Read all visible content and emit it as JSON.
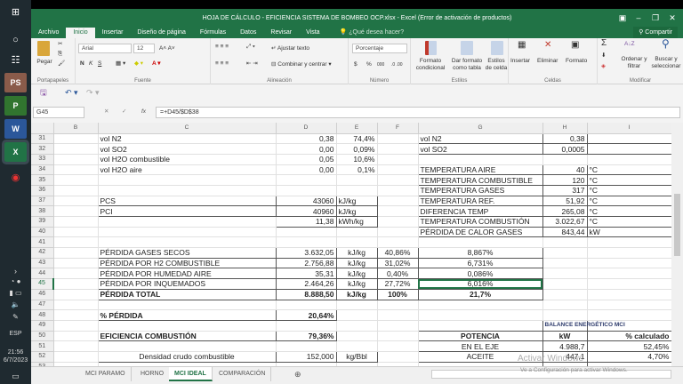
{
  "window": {
    "title": "HOJA DE CÁLCULO - EFICIENCIA SISTEMA DE BOMBEO OCP.xlsx - Excel (Error de activación de productos)",
    "share": "Compartir"
  },
  "ribbon_tabs": [
    "Archivo",
    "Inicio",
    "Insertar",
    "Diseño de página",
    "Fórmulas",
    "Datos",
    "Revisar",
    "Vista"
  ],
  "tell_me": "¿Qué desea hacer?",
  "ribbon": {
    "paste": "Pegar",
    "font_name": "Arial",
    "font_size": "12",
    "bold": "N",
    "italic": "K",
    "underline": "S",
    "wrap_text": "Ajustar texto",
    "merge_center": "Combinar y centrar",
    "number_format": "Porcentaje",
    "currency": "$",
    "percent": "%",
    "thousands": "000",
    "cond_format": "Formato condicional",
    "format_table": "Dar formato como tabla",
    "cell_styles": "Estilos de celda",
    "insert": "Insertar",
    "delete": "Eliminar",
    "format": "Formato",
    "sort_filter": "Ordenar y filtrar",
    "find_select": "Buscar y seleccionar",
    "groups": [
      "Portapapeles",
      "Fuente",
      "Alineación",
      "Número",
      "Estilos",
      "Celdas",
      "Modificar"
    ]
  },
  "formula_bar": {
    "name_box": "G45",
    "formula": "=+D45/$D$38"
  },
  "sheet": {
    "columns": [
      "B",
      "C",
      "D",
      "E",
      "F",
      "G",
      "H",
      "I"
    ],
    "rows": [
      {
        "n": "31",
        "C": "vol N2",
        "D": "0,38",
        "E": "74,4%",
        "G": "vol N2",
        "H": "0,38"
      },
      {
        "n": "32",
        "C": "vol SO2",
        "D": "0,00",
        "E": "0,09%",
        "G": "vol SO2",
        "H": "0,0005"
      },
      {
        "n": "33",
        "C": "vol H2O combustible",
        "D": "0,05",
        "E": "10,6%"
      },
      {
        "n": "34",
        "C": "vol H2O aire",
        "D": "0,00",
        "E": "0,1%",
        "G": "TEMPERATURA AIRE",
        "H": "40",
        "I": "°C"
      },
      {
        "n": "35",
        "G": "TEMPERATURA COMBUSTIBLE",
        "H": "120",
        "I": "°C"
      },
      {
        "n": "36",
        "G": "TEMPERATURA GASES",
        "H": "317",
        "I": "°C"
      },
      {
        "n": "37",
        "C": "PCS",
        "D": "43060",
        "E": "kJ/kg",
        "G": "TEMPERATURA REF.",
        "H": "51,92",
        "I": "°C"
      },
      {
        "n": "38",
        "C": "PCI",
        "D": "40960",
        "E": "kJ/kg",
        "G": "DIFERENCIA TEMP",
        "H": "265,08",
        "I": "°C"
      },
      {
        "n": "39",
        "D": "11,38",
        "E": "kWh/kg",
        "G": " TEMPERATURA COMBUSTIÓN",
        "H": "3.022,67",
        "I": "°C"
      },
      {
        "n": "40",
        "G": " PÉRDIDA DE CALOR GASES",
        "H": "843,44",
        "I": "kW"
      },
      {
        "n": "41"
      },
      {
        "n": "42",
        "C": "PÉRDIDA GASES SECOS",
        "D": "3.632,05",
        "E": "kJ/kg",
        "F": "40,86%",
        "G": "8,867%"
      },
      {
        "n": "43",
        "C": "PÉRDIDA POR H2 COMBUSTIBLE",
        "D": "2.756,88",
        "E": "kJ/kg",
        "F": "31,02%",
        "G": "6,731%"
      },
      {
        "n": "44",
        "C": "PÉRDIDA POR HUMEDAD AIRE",
        "D": "35,31",
        "E": "kJ/kg",
        "F": "0,40%",
        "G": "0,086%"
      },
      {
        "n": "45",
        "C": "PÉRDIDA POR INQUEMADOS",
        "D": "2.464,26",
        "E": "kJ/kg",
        "F": "27,72%",
        "G": "6,016%"
      },
      {
        "n": "46",
        "C": "PÉRDIDA TOTAL",
        "D": "8.888,50",
        "E": "kJ/kg",
        "F": "100%",
        "G": "21,7%"
      },
      {
        "n": "47"
      },
      {
        "n": "48",
        "C": "% PÉRDIDA",
        "D": "20,64%"
      },
      {
        "n": "49",
        "H": "BALANCE ENERGÉTICO MCI"
      },
      {
        "n": "50",
        "C": "EFICIENCIA COMBUSTIÓN",
        "D": "79,36%",
        "G": "POTENCIA",
        "H": "kW",
        "I": "% calculado"
      },
      {
        "n": "51",
        "G": "EN EL EJE",
        "H": "4.988,7",
        "I": "52,45%"
      },
      {
        "n": "52",
        "C": "Densidad crudo combustible",
        "D": "152,000",
        "E": "kg/Bbl",
        "G": "ACEITE",
        "H": "447,1",
        "I": "4,70%"
      },
      {
        "n": "53"
      }
    ]
  },
  "sheet_tabs": [
    "MCI PARAMO",
    "HORNO",
    "MCI IDEAL",
    "COMPARACIÓN"
  ],
  "active_sheet": "MCI IDEAL",
  "watermark": {
    "line1": "Activar Windows",
    "line2": "Ve a Configuración para activar Windows."
  },
  "taskbar": {
    "lang": "ESP",
    "time": "21:56",
    "date": "6/7/2023"
  },
  "colors": {
    "excel_green": "#217346"
  }
}
